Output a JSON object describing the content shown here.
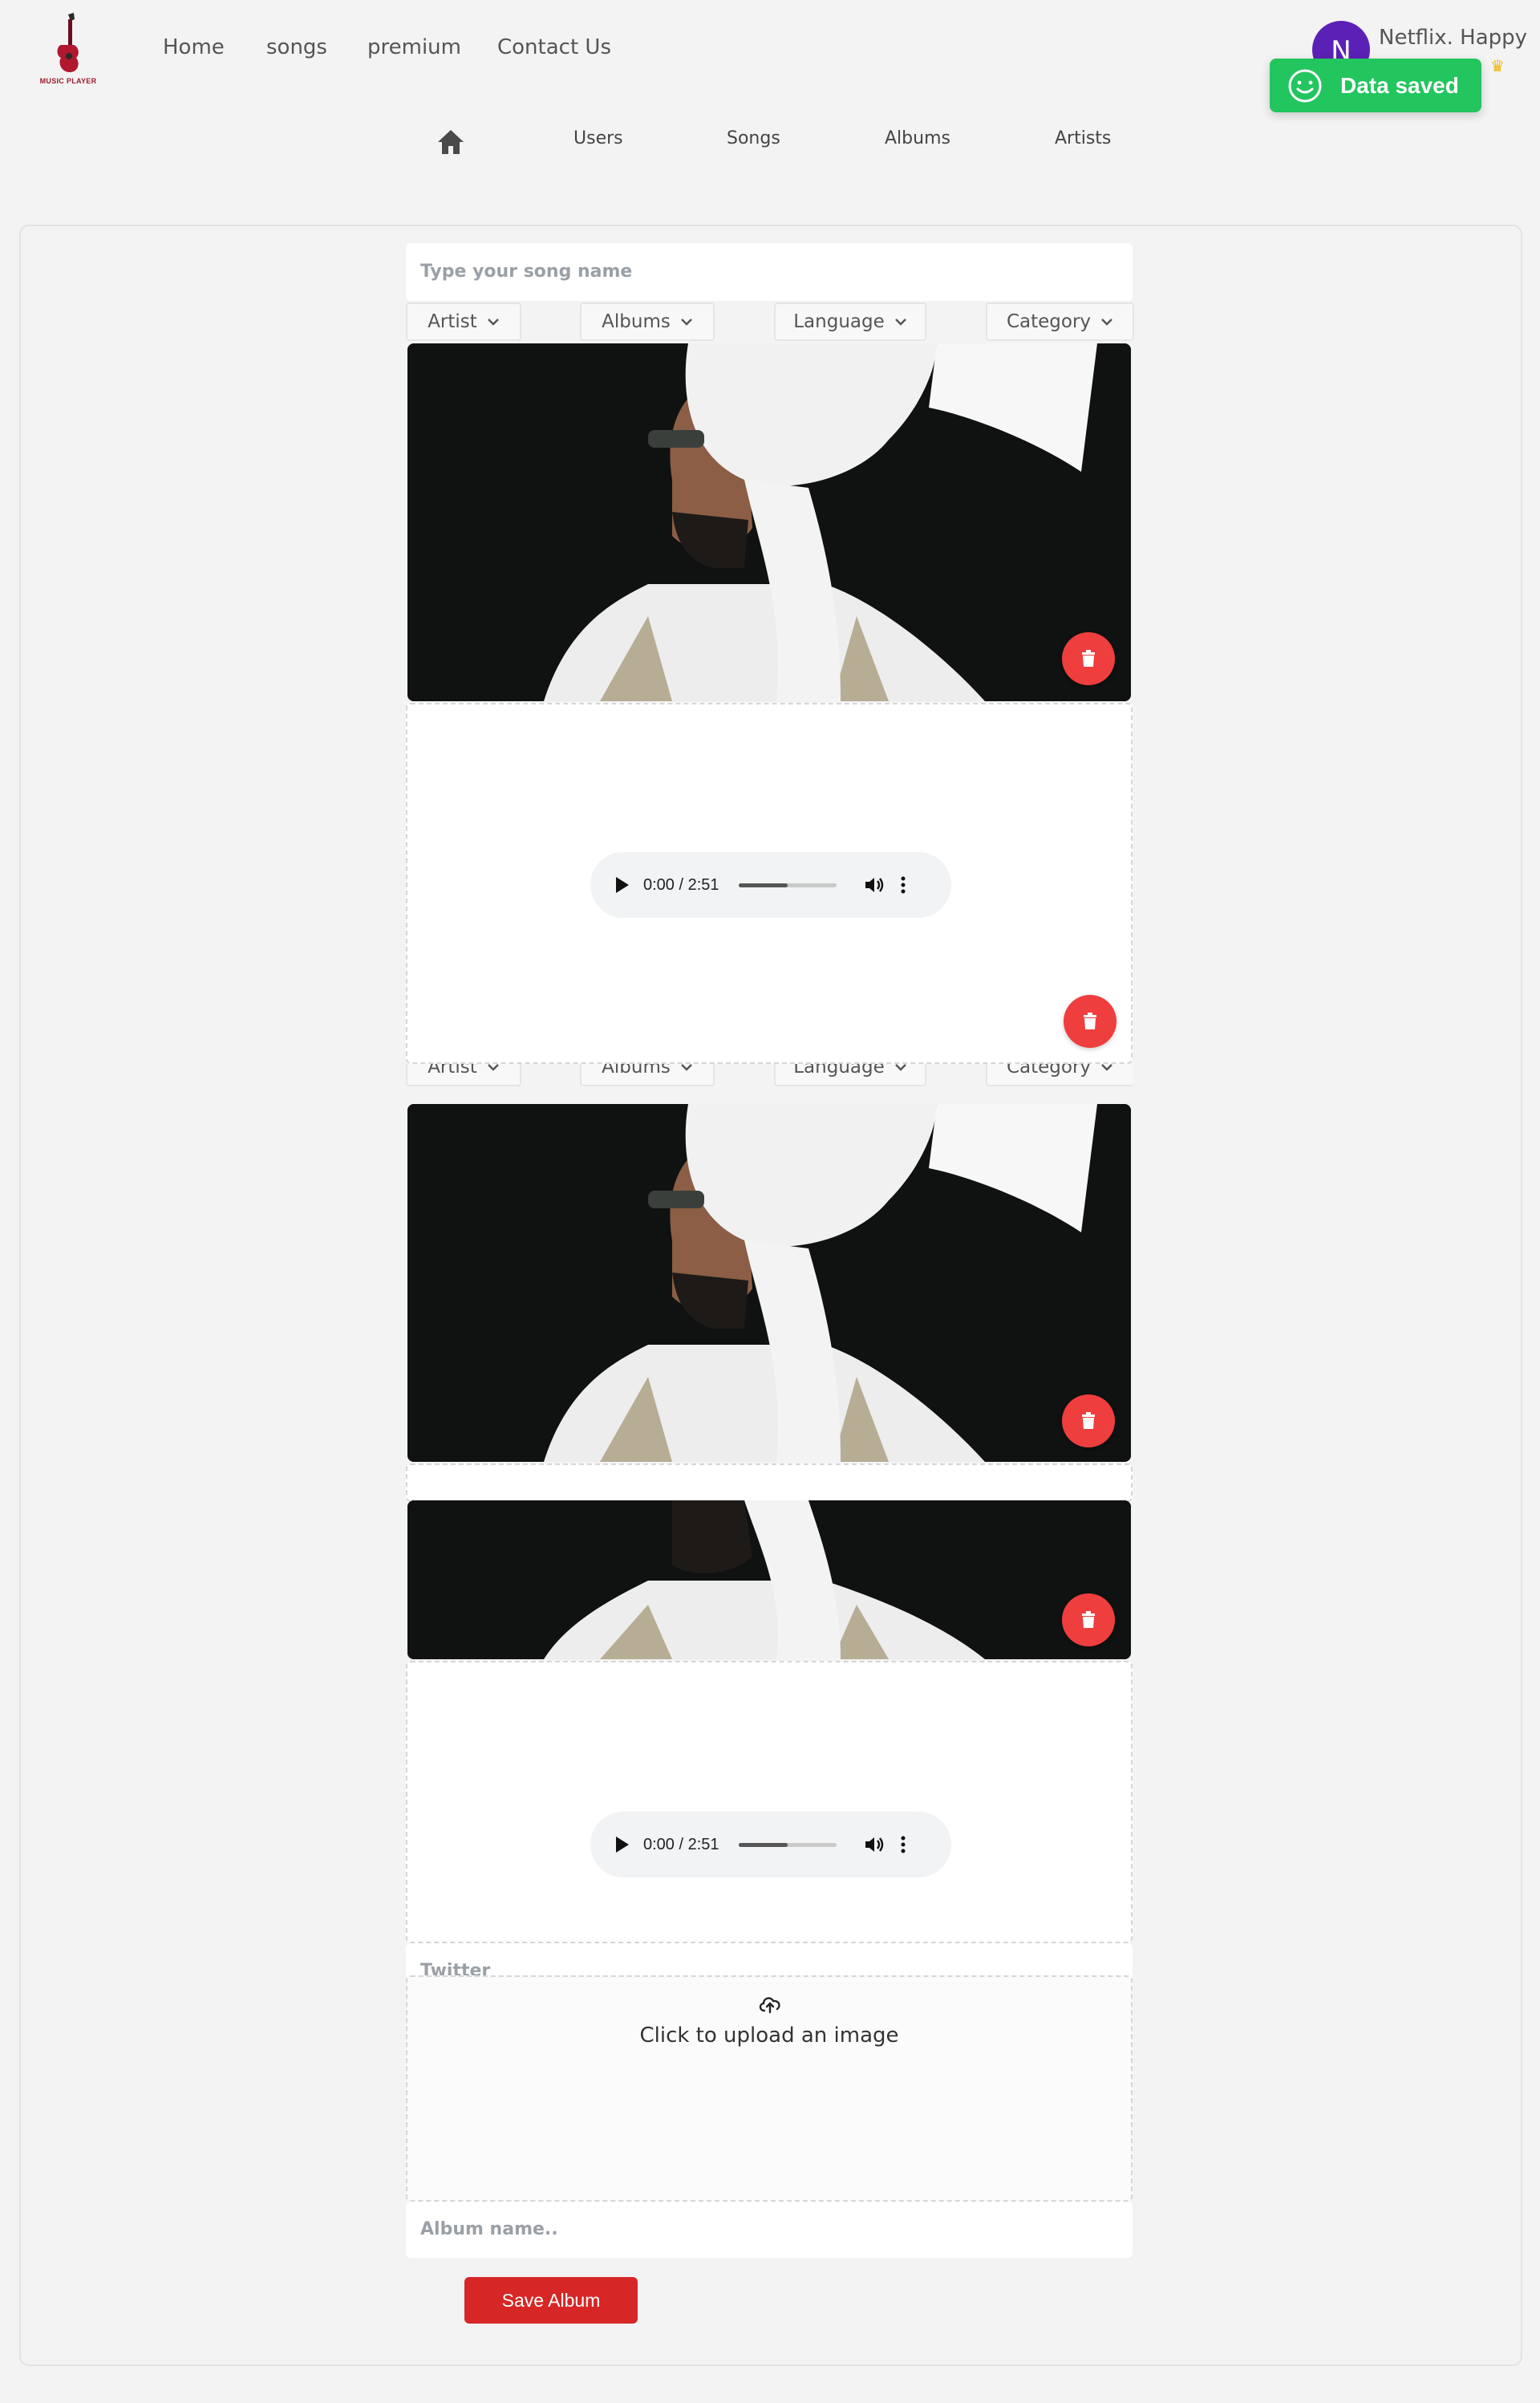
{
  "app": {
    "logo_text": "MUSIC PLAYER"
  },
  "nav": {
    "items": [
      "Home",
      "songs",
      "premium",
      "Contact Us"
    ]
  },
  "user": {
    "initial": "N",
    "name": "Netflix. Happy"
  },
  "toast": {
    "message": "Data saved"
  },
  "admin_nav": {
    "items": [
      "Users",
      "Songs",
      "Albums",
      "Artists"
    ]
  },
  "song_form": {
    "name_placeholder": "Type your song name",
    "filters": [
      "Artist",
      "Albums",
      "Language",
      "Category"
    ]
  },
  "audio": {
    "time": "0:00 / 2:51",
    "progress": 0.5
  },
  "album_form": {
    "twitter_placeholder": "Twitter",
    "upload_label": "Click to upload an image",
    "album_placeholder": "Album name..",
    "save_label": "Save Album"
  },
  "colors": {
    "primary_red": "#d72626",
    "toast_green": "#22c55e",
    "avatar_purple": "#5b21b6",
    "delete_red": "#ef3e3e"
  },
  "icons": [
    "home-icon",
    "delete-icon",
    "cloud-upload-icon",
    "smile-icon",
    "crown-icon",
    "volume-icon",
    "more-vertical-icon",
    "play-icon"
  ]
}
